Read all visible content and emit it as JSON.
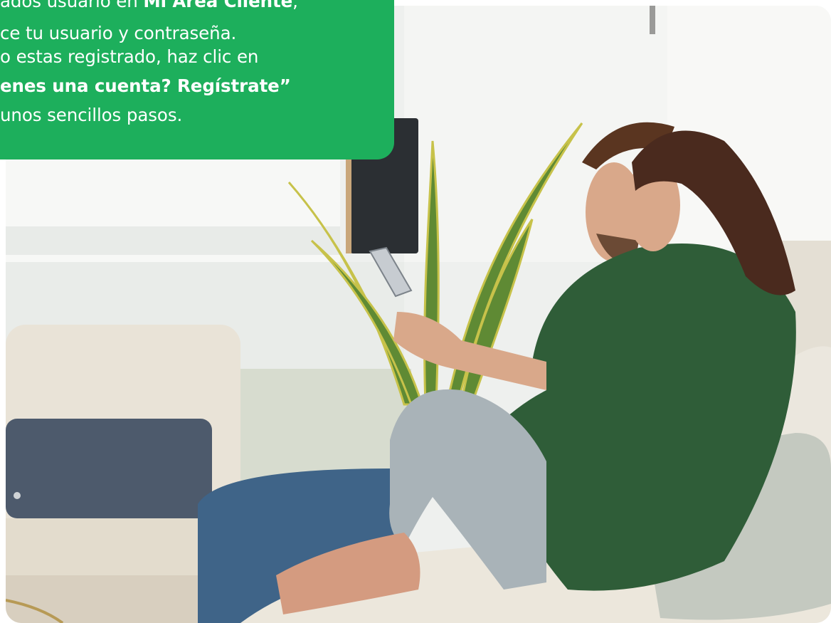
{
  "banner": {
    "line1_prefix": "ados usuario en ",
    "line1_bold": "Mi Área Cliente",
    "line1_suffix": ",",
    "line2": "ce tu usuario y contraseña.",
    "line3": "o estas registrado, haz clic en",
    "line4": "enes una cuenta? Regístrate”",
    "line5": "unos sencillos pasos."
  },
  "photo": {
    "subject": "couple-on-sofa-with-tablet",
    "colors": {
      "brand_green": "#1daf5c",
      "wall": "#eef0ee",
      "sofa": "#ece7dc",
      "cushion_blue": "#4d5a6c",
      "woman_shirt": "#2f5d38",
      "man_jeans": "#3f6488"
    }
  }
}
